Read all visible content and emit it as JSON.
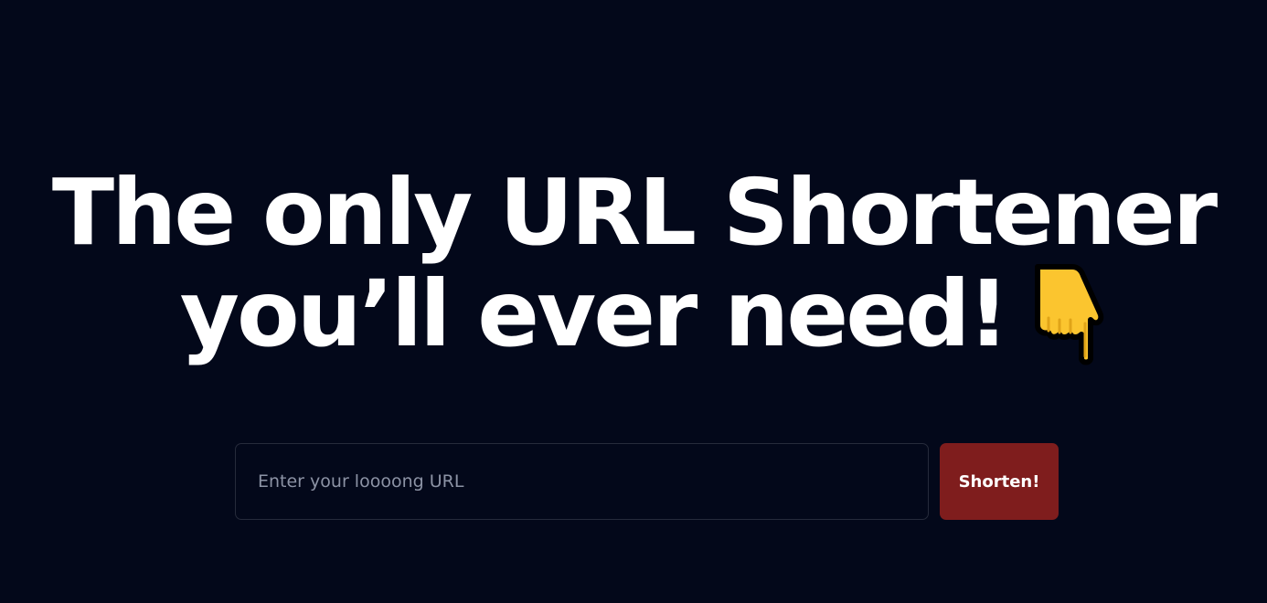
{
  "hero": {
    "headline_line1": "The only URL Shortener",
    "headline_line2": "you’ll ever need!",
    "emoji_icon": "backhand-index-pointing-down-icon"
  },
  "form": {
    "url_placeholder": "Enter your loooong URL",
    "url_value": "",
    "submit_label": "Shorten!"
  },
  "colors": {
    "background": "#03081a",
    "button": "#7f1d1d",
    "emoji": "#fbc52f"
  }
}
